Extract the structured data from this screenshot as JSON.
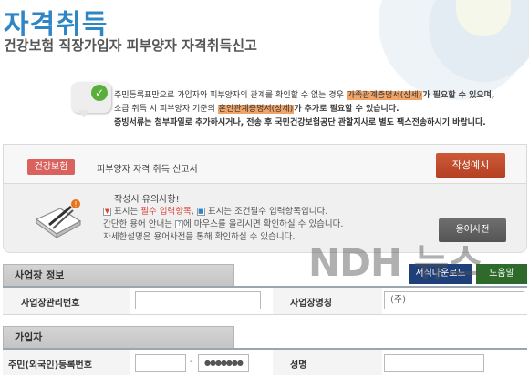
{
  "header": {
    "title": "자격취득",
    "subtitle": "건강보험 직장가입자 피부양자 자격취득신고"
  },
  "notice": {
    "line1_a": "주민등록표만으로 가입자와 피부양자의 관계를 확인할 수 없는 경우 ",
    "line1_hl": "가족관계증명서(상세)",
    "line1_b": "가 필요할 수 있으며,",
    "line2_a": "소급 취득 시 피부양자 기준의 ",
    "line2_hl": "혼인관계증명서(상세)",
    "line2_b": "가 추가로 필요할 수 있습니다.",
    "line3": "증빙서류는 첨부파일로 추가하시거나, 전송 후 국민건강보험공단 관할지사로 별도 팩스전송하시기 바랍니다."
  },
  "form_bar": {
    "badge": "건강보험",
    "form_name": "피부양자 자격 취득 신고서",
    "example_button": "작성예시"
  },
  "guide": {
    "title": "작성시 유의사항!",
    "line1_a": "표시는 ",
    "line1_red": "필수 입력항목",
    "line1_b": ", ",
    "line1_c": "표시는 조건필수 입력항목입니다.",
    "line2_a": "간단한 용어 안내는 ",
    "line2_b": "에 마우스를 올리시면 확인하실 수 있습니다.",
    "line3": "자세한설명은 용어사전을 통해 확인하실 수 있습니다.",
    "dictionary_button": "용어사전",
    "icon_required": "▼",
    "icon_conditional": "■",
    "icon_help": "?"
  },
  "watermark": "NDH 뉴스",
  "workplace": {
    "section_title": "사업장 정보",
    "download_button": "서식다운로드",
    "help_button": "도움말",
    "mgmt_no_label": "사업장관리번호",
    "mgmt_no_value": "",
    "name_label": "사업장명칭",
    "name_value": "(주)"
  },
  "subscriber": {
    "section_title": "가입자",
    "rrn_label": "주민(외국인)등록번호",
    "rrn_front": "",
    "rrn_dash": "-",
    "rrn_back": "●●●●●●●",
    "name_label": "성명",
    "name_value": ""
  },
  "colors": {
    "title_blue": "#2f86c6",
    "orange": "#e8721a",
    "badge_red": "#d9625f",
    "example_btn": "#c04b2b",
    "download_btn": "#1f3f7a",
    "help_btn": "#2e6b2a"
  }
}
